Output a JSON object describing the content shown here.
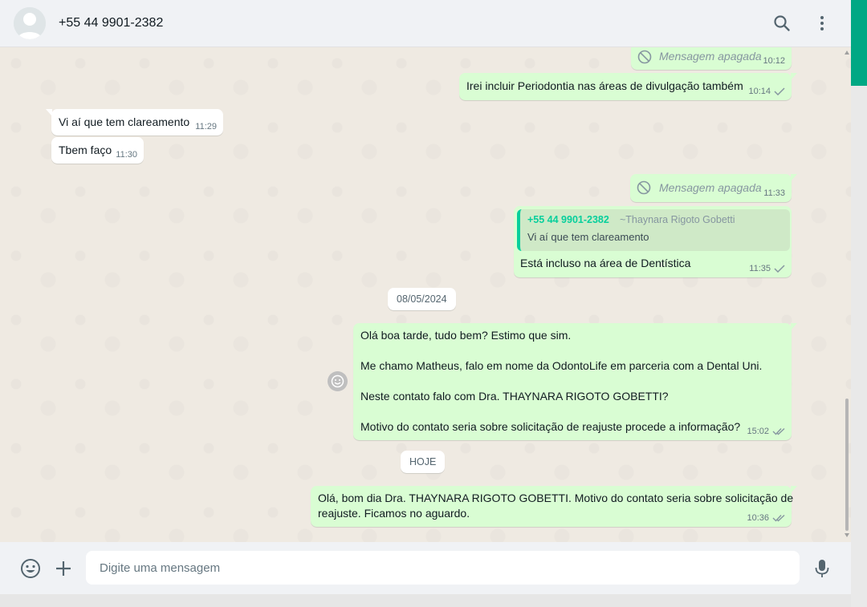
{
  "header": {
    "contact_name": "+55 44 9901-2382",
    "icons": [
      "search-icon",
      "menu-icon"
    ]
  },
  "messages": [
    {
      "id": "m1",
      "direction": "out",
      "deleted": true,
      "text": "Mensagem apagada",
      "time": "10:12"
    },
    {
      "id": "m2",
      "direction": "out",
      "text": "Irei incluir Periodontia nas áreas de divulgação também",
      "time": "10:14",
      "status": "sent"
    },
    {
      "id": "m3",
      "direction": "in",
      "text": "Vi aí que tem clareamento",
      "time": "11:29"
    },
    {
      "id": "m4",
      "direction": "in",
      "text": "Tbem faço",
      "time": "11:30"
    },
    {
      "id": "m5",
      "direction": "out",
      "deleted": true,
      "text": "Mensagem apagada",
      "time": "11:33"
    },
    {
      "id": "m6",
      "direction": "out",
      "quote": {
        "author": "+55 44 9901-2382",
        "author_name": "~Thaynara Rigoto Gobetti",
        "text": "Vi aí que tem clareamento"
      },
      "text": "Está incluso na área de Dentística",
      "time": "11:35",
      "status": "sent"
    },
    {
      "id": "d1",
      "type": "date",
      "text": "08/05/2024"
    },
    {
      "id": "m7",
      "direction": "out",
      "lines": [
        "Olá boa tarde, tudo bem? Estimo que sim.",
        "Me chamo Matheus, falo em nome da OdontoLife em parceria com a Dental Uni.",
        "Neste contato falo com Dra. THAYNARA RIGOTO GOBETTI?",
        "Motivo do contato seria sobre solicitação de reajuste procede a informação?"
      ],
      "time": "15:02",
      "status": "delivered"
    },
    {
      "id": "d2",
      "type": "date",
      "text": "HOJE"
    },
    {
      "id": "m8",
      "direction": "out",
      "lines": [
        "Olá, bom dia Dra. THAYNARA RIGOTO GOBETTI. Motivo do contato seria sobre solicitação de",
        "reajuste. Ficamos no aguardo."
      ],
      "time": "10:36",
      "status": "delivered"
    }
  ],
  "composer": {
    "placeholder": "Digite uma mensagem",
    "icons": [
      "emoji-icon",
      "attach-icon",
      "microphone-icon"
    ]
  },
  "colors": {
    "outgoing_bubble": "#d9fdd3",
    "incoming_bubble": "#ffffff",
    "accent": "#00a884",
    "quote_author": "#06cf9c"
  }
}
